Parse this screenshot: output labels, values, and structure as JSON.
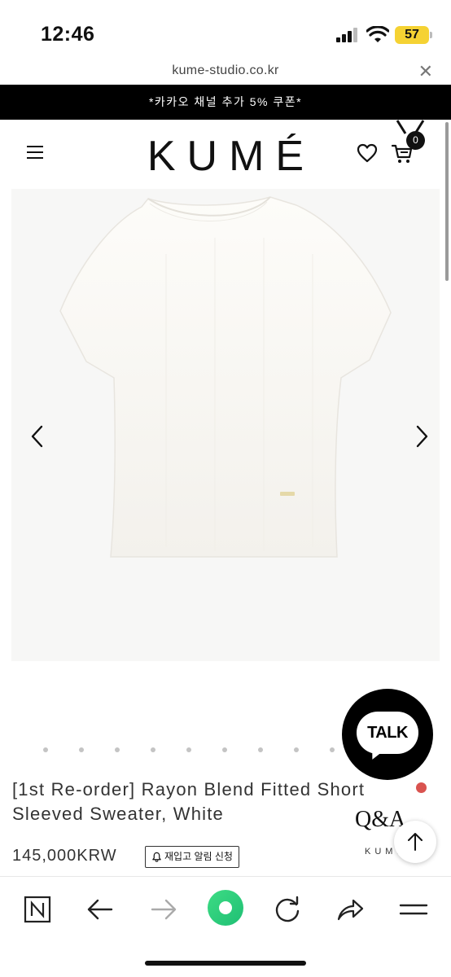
{
  "status_bar": {
    "time": "12:46",
    "battery": "57"
  },
  "url_bar": {
    "url": "kume-studio.co.kr",
    "close_label": "✕"
  },
  "promo_banner": {
    "text": "*카카오 채널 추가 5% 쿠폰*"
  },
  "header": {
    "logo": "KUMÉ",
    "cart_count": "0"
  },
  "product": {
    "image_count": 9,
    "title": "[1st Re-order] Rayon Blend Fitted Short Sleeved Sweater, White",
    "price": "145,000KRW",
    "restock_label": "재입고 알림 신청"
  },
  "floating": {
    "talk_label": "TALK",
    "qa_label": "Q&A",
    "qa_sub": "KUME"
  },
  "colors": {
    "accent": "#000000",
    "battery": "#f5d233",
    "notification_dot": "#d9534f",
    "browser_green": "#34c759"
  },
  "toolbar": {
    "icons": [
      "naver-icon",
      "back-icon",
      "forward-icon",
      "green-home-icon",
      "reload-icon",
      "share-icon",
      "menu-icon"
    ]
  }
}
